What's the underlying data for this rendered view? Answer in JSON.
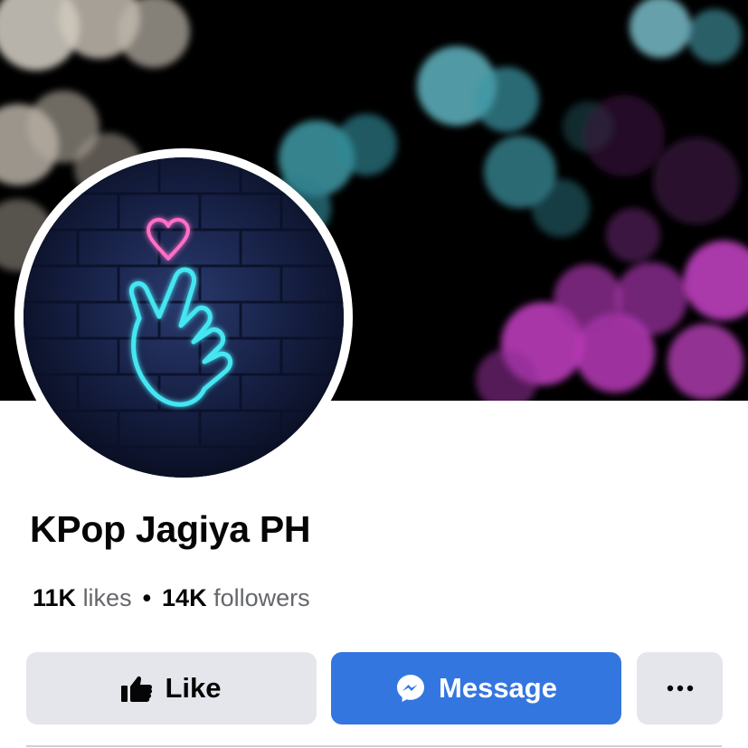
{
  "page": {
    "name": "KPop Jagiya PH"
  },
  "stats": {
    "likes_count": "11K",
    "likes_label": "likes",
    "separator": "•",
    "followers_count": "14K",
    "followers_label": "followers"
  },
  "actions": {
    "like_label": "Like",
    "like_icon": "thumbs-up-icon",
    "message_label": "Message",
    "message_icon": "messenger-icon",
    "more_icon": "more-options-icon",
    "more_label": "•••"
  },
  "colors": {
    "message_button": "#3476e0",
    "secondary_button": "#e4e6eb",
    "muted_text": "#65676b"
  }
}
